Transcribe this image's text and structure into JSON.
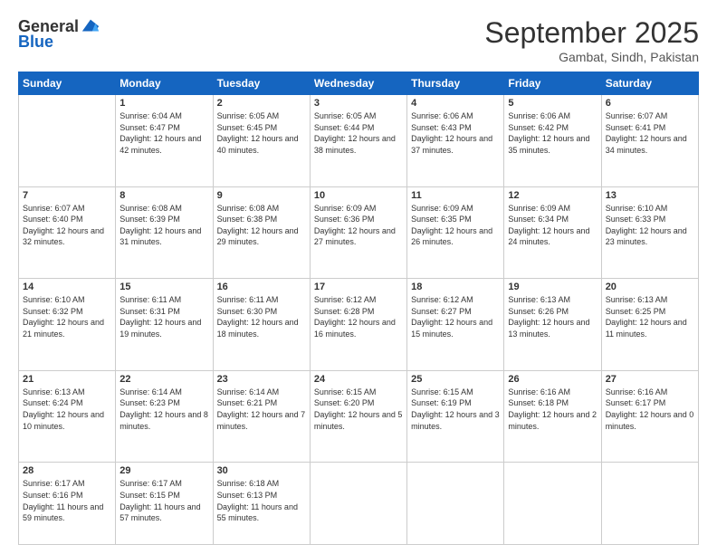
{
  "header": {
    "logo_general": "General",
    "logo_blue": "Blue",
    "month_title": "September 2025",
    "location": "Gambat, Sindh, Pakistan"
  },
  "weekdays": [
    "Sunday",
    "Monday",
    "Tuesday",
    "Wednesday",
    "Thursday",
    "Friday",
    "Saturday"
  ],
  "weeks": [
    [
      {
        "day": "",
        "sunrise": "",
        "sunset": "",
        "daylight": ""
      },
      {
        "day": "1",
        "sunrise": "Sunrise: 6:04 AM",
        "sunset": "Sunset: 6:47 PM",
        "daylight": "Daylight: 12 hours and 42 minutes."
      },
      {
        "day": "2",
        "sunrise": "Sunrise: 6:05 AM",
        "sunset": "Sunset: 6:45 PM",
        "daylight": "Daylight: 12 hours and 40 minutes."
      },
      {
        "day": "3",
        "sunrise": "Sunrise: 6:05 AM",
        "sunset": "Sunset: 6:44 PM",
        "daylight": "Daylight: 12 hours and 38 minutes."
      },
      {
        "day": "4",
        "sunrise": "Sunrise: 6:06 AM",
        "sunset": "Sunset: 6:43 PM",
        "daylight": "Daylight: 12 hours and 37 minutes."
      },
      {
        "day": "5",
        "sunrise": "Sunrise: 6:06 AM",
        "sunset": "Sunset: 6:42 PM",
        "daylight": "Daylight: 12 hours and 35 minutes."
      },
      {
        "day": "6",
        "sunrise": "Sunrise: 6:07 AM",
        "sunset": "Sunset: 6:41 PM",
        "daylight": "Daylight: 12 hours and 34 minutes."
      }
    ],
    [
      {
        "day": "7",
        "sunrise": "Sunrise: 6:07 AM",
        "sunset": "Sunset: 6:40 PM",
        "daylight": "Daylight: 12 hours and 32 minutes."
      },
      {
        "day": "8",
        "sunrise": "Sunrise: 6:08 AM",
        "sunset": "Sunset: 6:39 PM",
        "daylight": "Daylight: 12 hours and 31 minutes."
      },
      {
        "day": "9",
        "sunrise": "Sunrise: 6:08 AM",
        "sunset": "Sunset: 6:38 PM",
        "daylight": "Daylight: 12 hours and 29 minutes."
      },
      {
        "day": "10",
        "sunrise": "Sunrise: 6:09 AM",
        "sunset": "Sunset: 6:36 PM",
        "daylight": "Daylight: 12 hours and 27 minutes."
      },
      {
        "day": "11",
        "sunrise": "Sunrise: 6:09 AM",
        "sunset": "Sunset: 6:35 PM",
        "daylight": "Daylight: 12 hours and 26 minutes."
      },
      {
        "day": "12",
        "sunrise": "Sunrise: 6:09 AM",
        "sunset": "Sunset: 6:34 PM",
        "daylight": "Daylight: 12 hours and 24 minutes."
      },
      {
        "day": "13",
        "sunrise": "Sunrise: 6:10 AM",
        "sunset": "Sunset: 6:33 PM",
        "daylight": "Daylight: 12 hours and 23 minutes."
      }
    ],
    [
      {
        "day": "14",
        "sunrise": "Sunrise: 6:10 AM",
        "sunset": "Sunset: 6:32 PM",
        "daylight": "Daylight: 12 hours and 21 minutes."
      },
      {
        "day": "15",
        "sunrise": "Sunrise: 6:11 AM",
        "sunset": "Sunset: 6:31 PM",
        "daylight": "Daylight: 12 hours and 19 minutes."
      },
      {
        "day": "16",
        "sunrise": "Sunrise: 6:11 AM",
        "sunset": "Sunset: 6:30 PM",
        "daylight": "Daylight: 12 hours and 18 minutes."
      },
      {
        "day": "17",
        "sunrise": "Sunrise: 6:12 AM",
        "sunset": "Sunset: 6:28 PM",
        "daylight": "Daylight: 12 hours and 16 minutes."
      },
      {
        "day": "18",
        "sunrise": "Sunrise: 6:12 AM",
        "sunset": "Sunset: 6:27 PM",
        "daylight": "Daylight: 12 hours and 15 minutes."
      },
      {
        "day": "19",
        "sunrise": "Sunrise: 6:13 AM",
        "sunset": "Sunset: 6:26 PM",
        "daylight": "Daylight: 12 hours and 13 minutes."
      },
      {
        "day": "20",
        "sunrise": "Sunrise: 6:13 AM",
        "sunset": "Sunset: 6:25 PM",
        "daylight": "Daylight: 12 hours and 11 minutes."
      }
    ],
    [
      {
        "day": "21",
        "sunrise": "Sunrise: 6:13 AM",
        "sunset": "Sunset: 6:24 PM",
        "daylight": "Daylight: 12 hours and 10 minutes."
      },
      {
        "day": "22",
        "sunrise": "Sunrise: 6:14 AM",
        "sunset": "Sunset: 6:23 PM",
        "daylight": "Daylight: 12 hours and 8 minutes."
      },
      {
        "day": "23",
        "sunrise": "Sunrise: 6:14 AM",
        "sunset": "Sunset: 6:21 PM",
        "daylight": "Daylight: 12 hours and 7 minutes."
      },
      {
        "day": "24",
        "sunrise": "Sunrise: 6:15 AM",
        "sunset": "Sunset: 6:20 PM",
        "daylight": "Daylight: 12 hours and 5 minutes."
      },
      {
        "day": "25",
        "sunrise": "Sunrise: 6:15 AM",
        "sunset": "Sunset: 6:19 PM",
        "daylight": "Daylight: 12 hours and 3 minutes."
      },
      {
        "day": "26",
        "sunrise": "Sunrise: 6:16 AM",
        "sunset": "Sunset: 6:18 PM",
        "daylight": "Daylight: 12 hours and 2 minutes."
      },
      {
        "day": "27",
        "sunrise": "Sunrise: 6:16 AM",
        "sunset": "Sunset: 6:17 PM",
        "daylight": "Daylight: 12 hours and 0 minutes."
      }
    ],
    [
      {
        "day": "28",
        "sunrise": "Sunrise: 6:17 AM",
        "sunset": "Sunset: 6:16 PM",
        "daylight": "Daylight: 11 hours and 59 minutes."
      },
      {
        "day": "29",
        "sunrise": "Sunrise: 6:17 AM",
        "sunset": "Sunset: 6:15 PM",
        "daylight": "Daylight: 11 hours and 57 minutes."
      },
      {
        "day": "30",
        "sunrise": "Sunrise: 6:18 AM",
        "sunset": "Sunset: 6:13 PM",
        "daylight": "Daylight: 11 hours and 55 minutes."
      },
      {
        "day": "",
        "sunrise": "",
        "sunset": "",
        "daylight": ""
      },
      {
        "day": "",
        "sunrise": "",
        "sunset": "",
        "daylight": ""
      },
      {
        "day": "",
        "sunrise": "",
        "sunset": "",
        "daylight": ""
      },
      {
        "day": "",
        "sunrise": "",
        "sunset": "",
        "daylight": ""
      }
    ]
  ]
}
